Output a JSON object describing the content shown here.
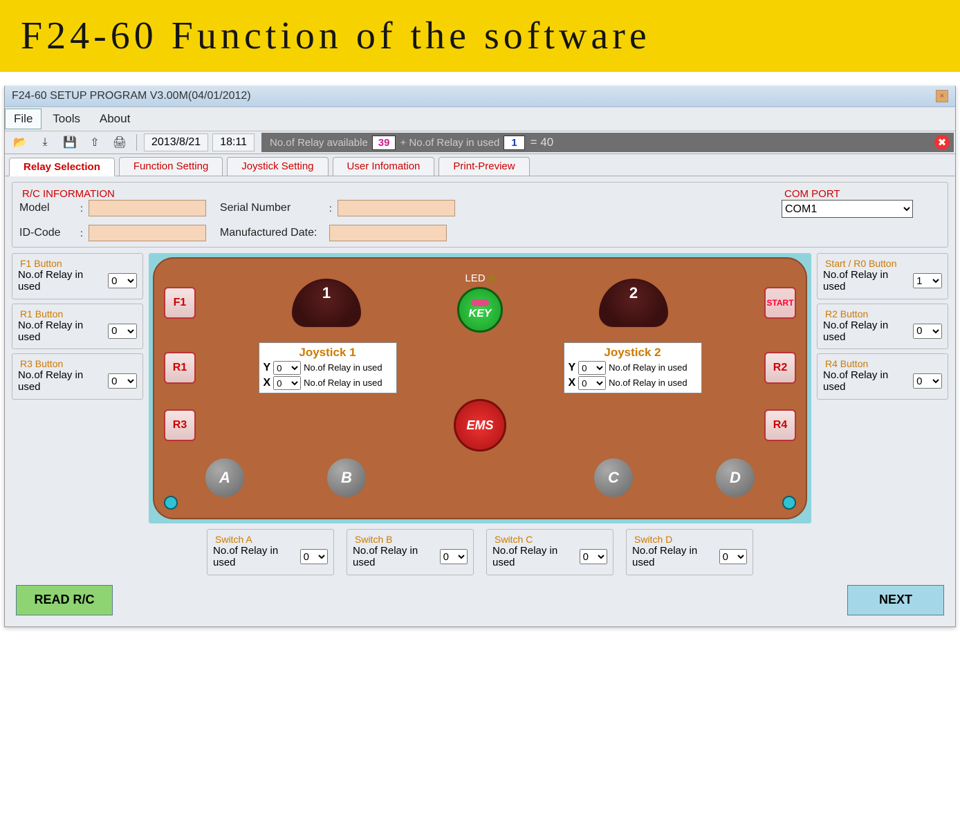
{
  "header_title": "F24-60 Function of the software",
  "window_title": "F24-60 SETUP PROGRAM V3.00M(04/01/2012)",
  "menu": {
    "file": "File",
    "tools": "Tools",
    "about": "About"
  },
  "toolbar": {
    "date": "2013/8/21",
    "time": "18:11",
    "relay_available_label": "No.of Relay available",
    "relay_available_value": "39",
    "relay_used_label": "+ No.of Relay in used",
    "relay_used_value": "1",
    "relay_total": "= 40"
  },
  "tabs": {
    "relay_selection": "Relay Selection",
    "function_setting": "Function Setting",
    "joystick_setting": "Joystick Setting",
    "user_information": "User Infomation",
    "print_preview": "Print-Preview"
  },
  "rc_info": {
    "legend": "R/C INFORMATION",
    "model_label": "Model",
    "model_value": "",
    "idcode_label": "ID-Code",
    "idcode_value": "",
    "serial_label": "Serial Number",
    "serial_value": "",
    "mfg_label": "Manufactured Date:",
    "mfg_value": ""
  },
  "com_port": {
    "legend": "COM PORT",
    "value": "COM1"
  },
  "left_boxes": {
    "f1": {
      "legend": "F1 Button",
      "label": "No.of Relay in used",
      "value": "0"
    },
    "r1": {
      "legend": "R1 Button",
      "label": "No.of Relay in used",
      "value": "0"
    },
    "r3": {
      "legend": "R3 Button",
      "label": "No.of Relay in used",
      "value": "0"
    }
  },
  "right_boxes": {
    "start": {
      "legend": "Start / R0 Button",
      "label": "No.of Relay in used",
      "value": "1"
    },
    "r2": {
      "legend": "R2 Button",
      "label": "No.of Relay in used",
      "value": "0"
    },
    "r4": {
      "legend": "R4 Button",
      "label": "No.of Relay in used",
      "value": "0"
    }
  },
  "device": {
    "f1": "F1",
    "r1": "R1",
    "r3": "R3",
    "start": "START",
    "r2": "R2",
    "r4": "R4",
    "joy1_num": "1",
    "joy2_num": "2",
    "led": "LED",
    "key": "KEY",
    "ems": "EMS",
    "a": "A",
    "b": "B",
    "c": "C",
    "d": "D",
    "joy1": {
      "title": "Joystick 1",
      "y_label": "Y",
      "y_value": "0",
      "x_label": "X",
      "x_value": "0",
      "desc": "No.of Relay in used"
    },
    "joy2": {
      "title": "Joystick 2",
      "y_label": "Y",
      "y_value": "0",
      "x_label": "X",
      "x_value": "0",
      "desc": "No.of Relay in used"
    }
  },
  "switches": {
    "a": {
      "legend": "Switch A",
      "label": "No.of Relay in used",
      "value": "0"
    },
    "b": {
      "legend": "Switch B",
      "label": "No.of Relay in used",
      "value": "0"
    },
    "c": {
      "legend": "Switch C",
      "label": "No.of Relay in used",
      "value": "0"
    },
    "d": {
      "legend": "Switch D",
      "label": "No.of Relay in used",
      "value": "0"
    }
  },
  "actions": {
    "read": "READ R/C",
    "next": "NEXT"
  },
  "colon": ":"
}
